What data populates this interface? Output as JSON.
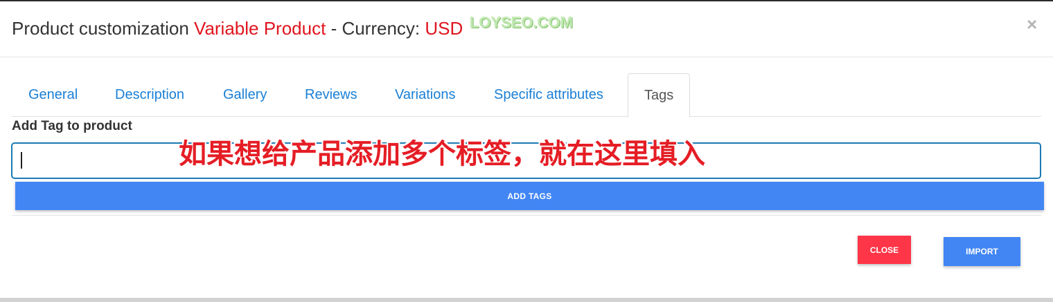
{
  "modal": {
    "title_prefix": "Product customization",
    "product_type": "Variable Product",
    "title_separator": "- Currency:",
    "currency": "USD",
    "close_icon": "×"
  },
  "watermark": "LOYSEO.COM",
  "tabs": [
    {
      "label": "General",
      "active": false
    },
    {
      "label": "Description",
      "active": false
    },
    {
      "label": "Gallery",
      "active": false
    },
    {
      "label": "Reviews",
      "active": false
    },
    {
      "label": "Variations",
      "active": false
    },
    {
      "label": "Specific attributes",
      "active": false
    },
    {
      "label": "Tags",
      "active": true
    }
  ],
  "tags_panel": {
    "field_label": "Add Tag to product",
    "input_value": "",
    "add_button_label": "ADD TAGS",
    "annotation": "如果想给产品添加多个标签，就在这里填入"
  },
  "footer": {
    "close_label": "CLOSE",
    "import_label": "IMPORT"
  },
  "colors": {
    "accent_blue": "#4286f4",
    "danger_red": "#ff3548",
    "link_blue": "#1a7fd6",
    "title_red": "#e0141e"
  }
}
